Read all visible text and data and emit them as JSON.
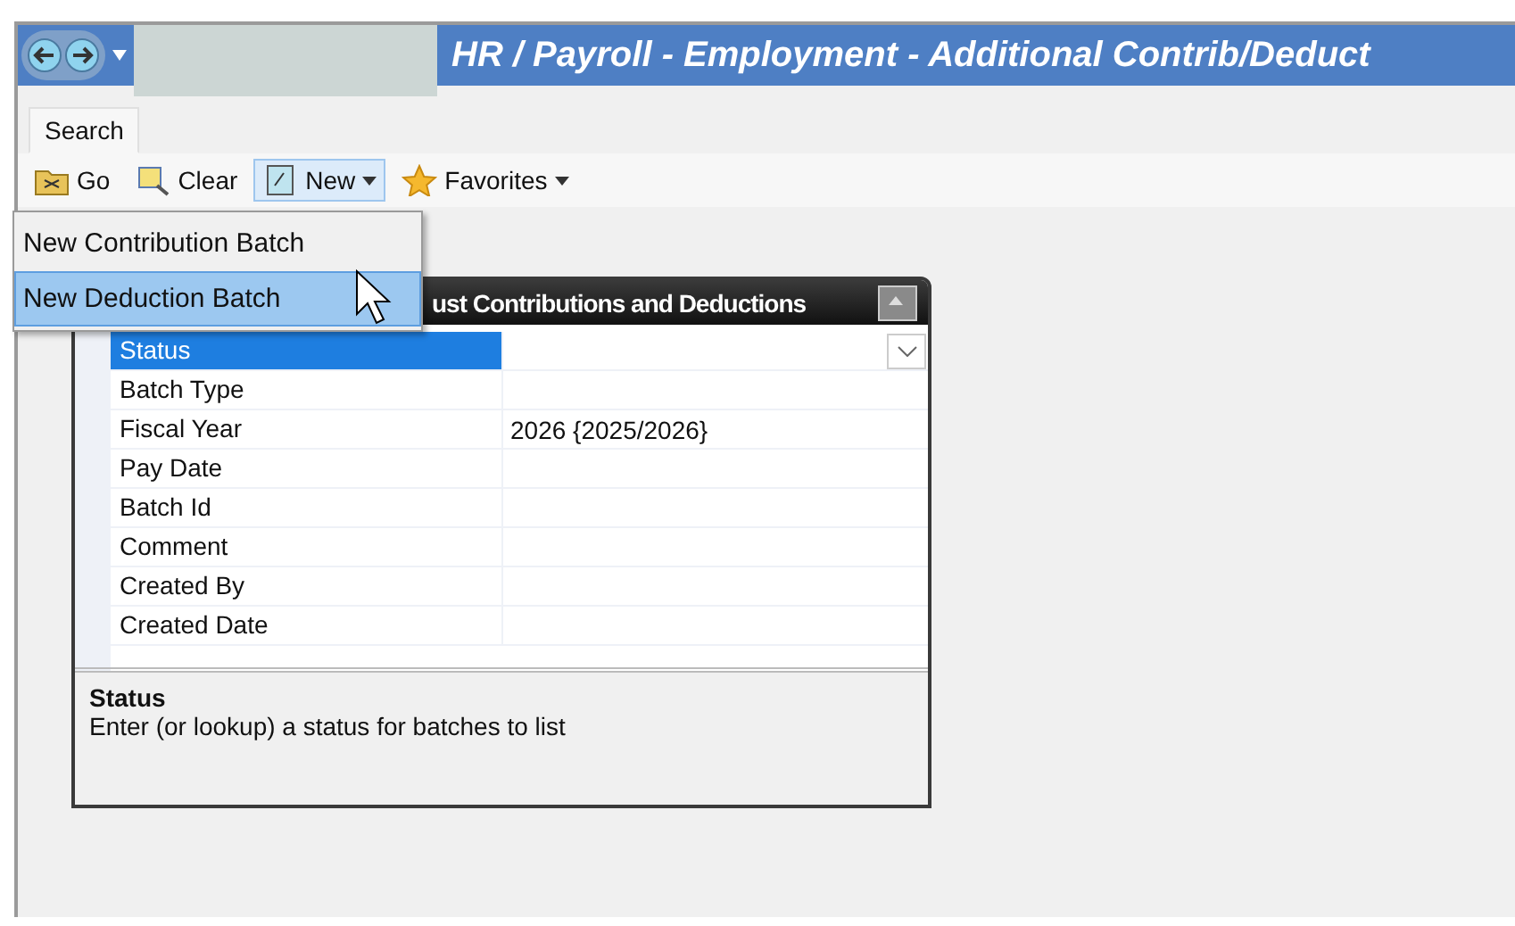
{
  "window": {
    "title": "HR / Payroll - Employment - Additional Contrib/Deduct"
  },
  "tabs": [
    {
      "label": "Search",
      "selected": true
    }
  ],
  "toolbar": [
    {
      "label": "Go",
      "dropdown": false,
      "expanded": false
    },
    {
      "label": "Clear",
      "dropdown": false,
      "expanded": false
    },
    {
      "label": "New",
      "dropdown": true,
      "expanded": true
    },
    {
      "label": "Favorites",
      "dropdown": true,
      "expanded": false
    }
  ],
  "menu": [
    {
      "label": "New Contribution Batch",
      "selected": false
    },
    {
      "label": "New Deduction Batch",
      "selected": true
    }
  ],
  "panel": {
    "title": "ust Contributions and Deductions",
    "properties": [
      {
        "label": "Status",
        "selected": true,
        "lookup": true
      },
      {
        "label": "Batch Type",
        "selected": false
      },
      {
        "label": "Fiscal Year",
        "value": "2026 {2025/2026}",
        "selected": false
      },
      {
        "label": "Pay Date",
        "selected": false
      },
      {
        "label": "Batch Id",
        "selected": false
      },
      {
        "label": "Comment",
        "selected": false
      },
      {
        "label": "Created By",
        "selected": false
      },
      {
        "label": "Created Date",
        "selected": false
      }
    ],
    "help": {
      "title": "Status",
      "text": "Enter (or lookup) a status for batches to list"
    }
  }
}
